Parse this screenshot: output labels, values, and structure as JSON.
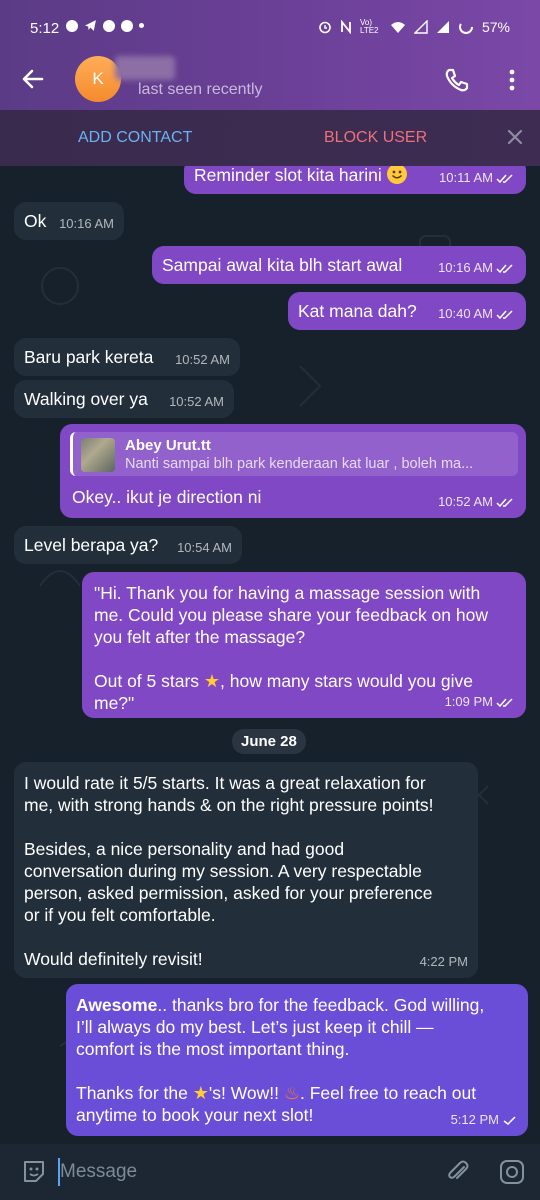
{
  "status_bar": {
    "time": "5:12",
    "battery": "57%",
    "lte_label": "Vo) LTE2"
  },
  "header": {
    "avatar_initial": "K",
    "status": "last seen recently"
  },
  "action_bar": {
    "add_contact": "ADD CONTACT",
    "block_user": "BLOCK USER"
  },
  "messages": [
    {
      "text": "Reminder slot kita harini",
      "time": "10:11 AM"
    },
    {
      "text": "Ok",
      "time": "10:16 AM"
    },
    {
      "text": "Sampai awal kita blh start awal",
      "time": "10:16 AM"
    },
    {
      "text": "Kat mana dah?",
      "time": "10:40 AM"
    },
    {
      "text": "Baru park kereta",
      "time": "10:52 AM"
    },
    {
      "text": "Walking over ya",
      "time": "10:52 AM"
    },
    {
      "text": "Okey.. ikut je direction ni",
      "time": "10:52 AM",
      "reply_name": "Abey Urut.tt",
      "reply_text": "Nanti sampai blh park kenderaan kat luar , boleh ma..."
    },
    {
      "text": "Level berapa ya?",
      "time": "10:54 AM"
    },
    {
      "line1": "\"Hi. Thank you for having a massage session with",
      "line2": "me. Could you please share your feedback on how",
      "line3": "you felt after the massage?",
      "line4a": "Out of 5 stars ",
      "line4b": ", how many stars would you give",
      "line5": "me?\"",
      "time": "1:09 PM"
    },
    {
      "line1": "I would rate it 5/5 starts. It was a great relaxation for",
      "line2": "me, with strong hands & on the right pressure points!",
      "line3": "Besides, a nice personality and had good",
      "line4": "conversation during my session. A very respectable",
      "line5": "person, asked permission, asked for your preference",
      "line6": "or if you felt comfortable.",
      "line7": "Would definitely revisit!",
      "time": "4:22 PM"
    },
    {
      "bold": "Awesome",
      "line1": ".. thanks bro for the feedback. God willing,",
      "line2": "I’ll always do my best. Let’s just keep it chill —",
      "line3": "comfort is the most important thing.",
      "line4a": "Thanks for the ",
      "line4b": "'s! Wow!! ",
      "line4c": ". Feel free to reach out",
      "line5": "anytime to book your next slot!",
      "time": "5:12 PM"
    }
  ],
  "date_separator": "June 28",
  "input": {
    "placeholder": "Message"
  },
  "colors": {
    "outgoing_bubble": "#8048c4",
    "incoming_bubble": "#222e3a",
    "chat_background": "#17212b",
    "accent_link": "#6ab2f2",
    "danger": "#ef6f7b"
  }
}
